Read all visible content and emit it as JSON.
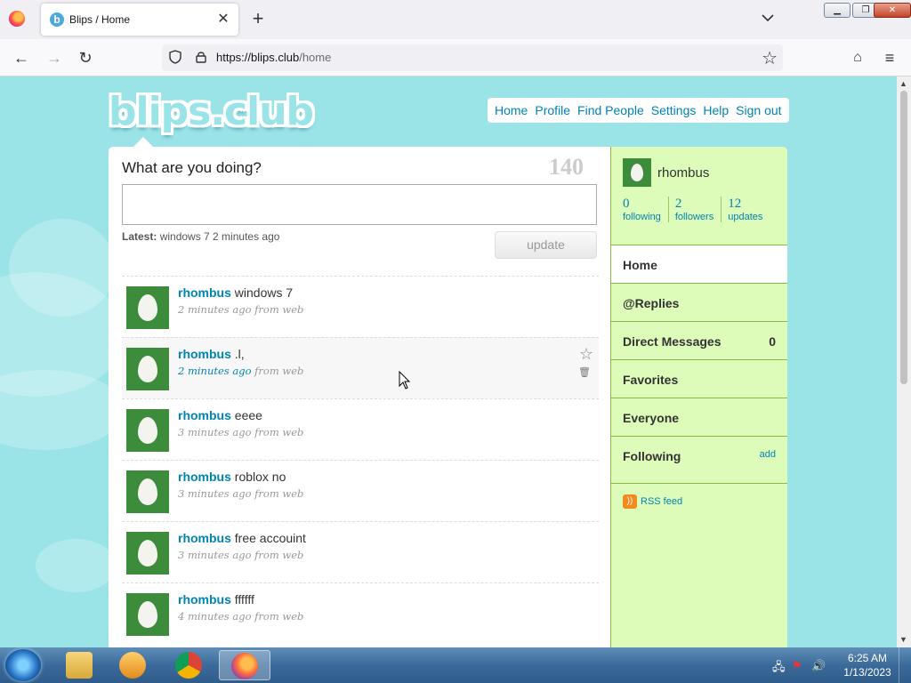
{
  "browser": {
    "tab_title": "Blips / Home",
    "tab_close_glyph": "✕",
    "new_tab_glyph": "+",
    "url_host": "https://blips.club",
    "url_path": "/home",
    "back_glyph": "←",
    "forward_glyph": "→",
    "reload_glyph": "↻",
    "bookmark_glyph": "☆",
    "pocket_glyph": "⌂",
    "menu_glyph": "≡",
    "tab_list_glyph": "⌄",
    "win_min": "▁",
    "win_max": "❐",
    "win_close": "✕"
  },
  "site": {
    "logo": "blips.club",
    "nav": [
      "Home",
      "Profile",
      "Find People",
      "Settings",
      "Help",
      "Sign out"
    ]
  },
  "composer": {
    "prompt": "What are you doing?",
    "counter": "140",
    "latest_label": "Latest:",
    "latest_text": "windows 7 2 minutes ago",
    "update_label": "update"
  },
  "timeline": [
    {
      "user": "rhombus",
      "text": "windows 7",
      "time": "2 minutes ago",
      "source": "from web"
    },
    {
      "user": "rhombus",
      "text": ".l,",
      "time": "2 minutes ago",
      "source": "from web"
    },
    {
      "user": "rhombus",
      "text": "eeee",
      "time": "3 minutes ago",
      "source": "from web"
    },
    {
      "user": "rhombus",
      "text": "roblox no",
      "time": "3 minutes ago",
      "source": "from web"
    },
    {
      "user": "rhombus",
      "text": "free accouint",
      "time": "3 minutes ago",
      "source": "from web"
    },
    {
      "user": "rhombus",
      "text": "ffffff",
      "time": "4 minutes ago",
      "source": "from web"
    }
  ],
  "tweet_actions": {
    "favorite_glyph": "☆",
    "delete_glyph": "🗑"
  },
  "sidebar": {
    "username": "rhombus",
    "stats": [
      {
        "num": "0",
        "label": "following"
      },
      {
        "num": "2",
        "label": "followers"
      },
      {
        "num": "12",
        "label": "updates"
      }
    ],
    "menu": {
      "home": "Home",
      "replies": "@Replies",
      "dm": "Direct Messages",
      "dm_count": "0",
      "favorites": "Favorites",
      "everyone": "Everyone",
      "following": "Following",
      "add": "add"
    },
    "rss": "RSS feed"
  },
  "taskbar": {
    "time": "6:25 AM",
    "date": "1/13/2023"
  },
  "colors": {
    "page_bg": "#9ae4e8",
    "link": "#0084b4",
    "sidebar_bg": "#ddfcba",
    "sidebar_border": "#87bc44",
    "avatar_green": "#3c8c3c"
  }
}
